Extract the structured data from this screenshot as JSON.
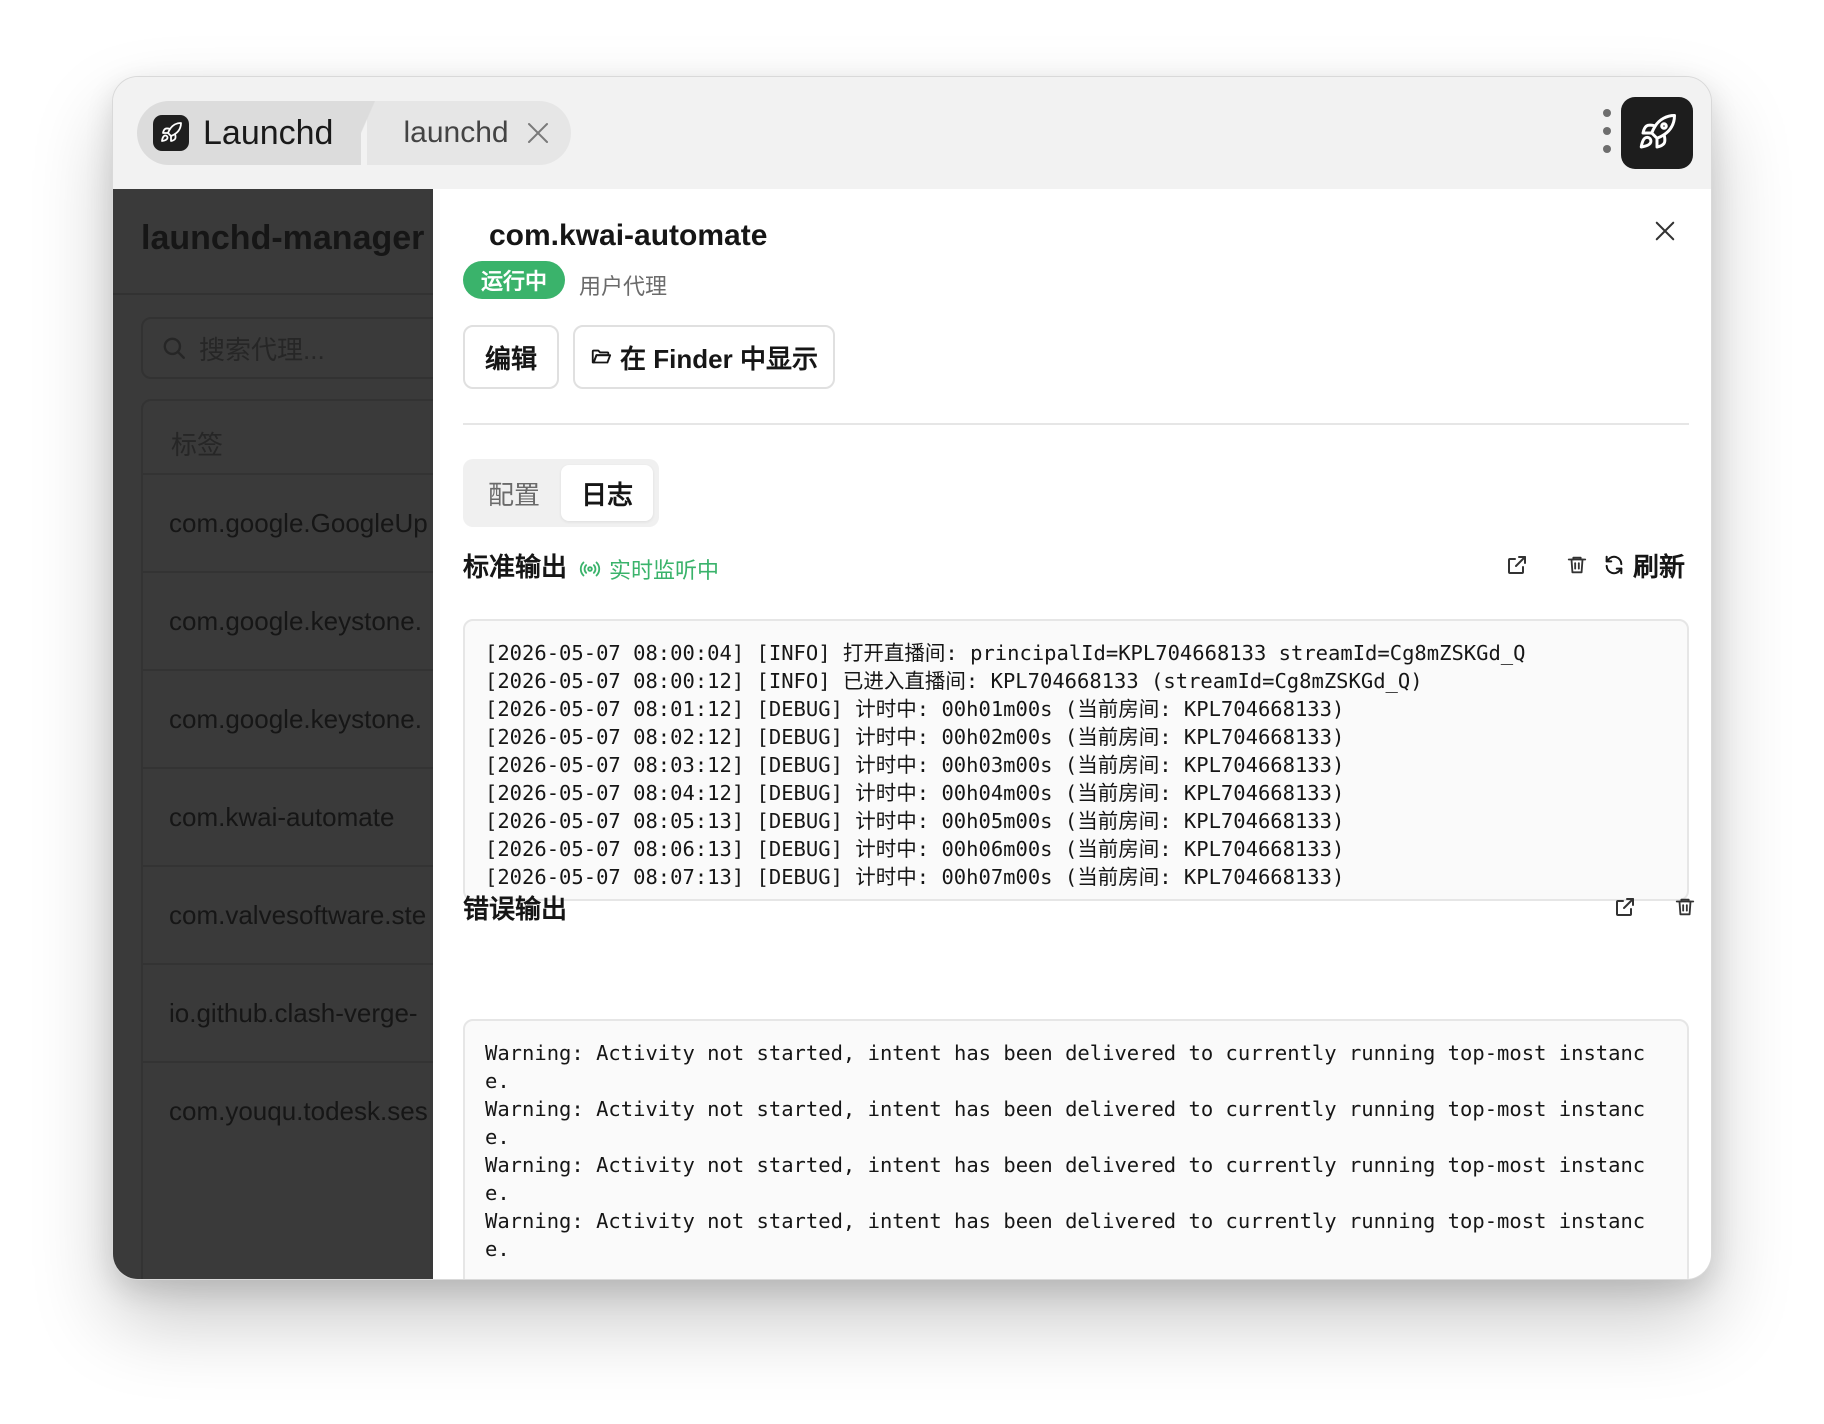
{
  "titlebar": {
    "app_tab_title": "Launchd",
    "doc_tab_title": "launchd"
  },
  "sidebar": {
    "title": "launchd-manager",
    "search_placeholder": "搜索代理...",
    "list_header": "标签",
    "items": [
      "com.google.GoogleUp",
      "com.google.keystone.",
      "com.google.keystone.",
      "com.kwai-automate",
      "com.valvesoftware.ste",
      "io.github.clash-verge-",
      "com.youqu.todesk.ses"
    ]
  },
  "detail": {
    "label": "com.kwai-automate",
    "status": "运行中",
    "status_color": "#3ab36b",
    "agent_type": "用户代理",
    "edit_label": "编辑",
    "finder_label": "在 Finder 中显示",
    "tabs": [
      "配置",
      "日志"
    ],
    "active_tab": "日志",
    "stdout": {
      "title": "标准输出",
      "live_label": "实时监听中",
      "refresh_label": "刷新",
      "lines": [
        "[2026-05-07 08:00:04] [INFO] 打开直播间: principalId=KPL704668133 streamId=Cg8mZSKGd_Q",
        "[2026-05-07 08:00:12] [INFO] 已进入直播间: KPL704668133 (streamId=Cg8mZSKGd_Q)",
        "[2026-05-07 08:01:12] [DEBUG] 计时中: 00h01m00s (当前房间: KPL704668133)",
        "[2026-05-07 08:02:12] [DEBUG] 计时中: 00h02m00s (当前房间: KPL704668133)",
        "[2026-05-07 08:03:12] [DEBUG] 计时中: 00h03m00s (当前房间: KPL704668133)",
        "[2026-05-07 08:04:12] [DEBUG] 计时中: 00h04m00s (当前房间: KPL704668133)",
        "[2026-05-07 08:05:13] [DEBUG] 计时中: 00h05m00s (当前房间: KPL704668133)",
        "[2026-05-07 08:06:13] [DEBUG] 计时中: 00h06m00s (当前房间: KPL704668133)",
        "[2026-05-07 08:07:13] [DEBUG] 计时中: 00h07m00s (当前房间: KPL704668133)"
      ]
    },
    "stderr": {
      "title": "错误输出",
      "lines": [
        "Warning: Activity not started, intent has been delivered to currently running top-most instance.",
        "Warning: Activity not started, intent has been delivered to currently running top-most instance.",
        "Warning: Activity not started, intent has been delivered to currently running top-most instance.",
        "Warning: Activity not started, intent has been delivered to currently running top-most instance."
      ]
    }
  }
}
